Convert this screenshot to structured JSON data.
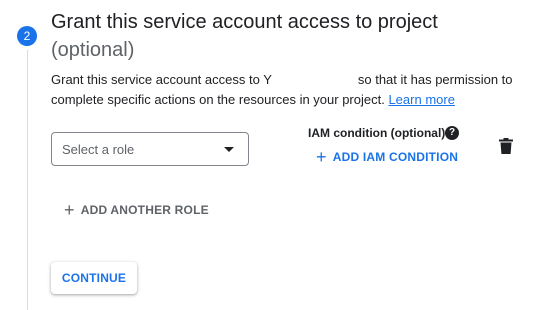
{
  "step": {
    "number": "2",
    "title": "Grant this service account access to project",
    "optional": "(optional)"
  },
  "description": {
    "before": "Grant this service account access to ",
    "hidden_fragment": "Y",
    "after": "so that it has permission to complete specific actions on the resources in your project. ",
    "link": "Learn more"
  },
  "role": {
    "placeholder": "Select a role"
  },
  "iam": {
    "label": "IAM condition (optional)",
    "help_glyph": "?",
    "add_label": "ADD IAM CONDITION"
  },
  "actions": {
    "plus_glyph": "+",
    "add_role_label": "ADD ANOTHER ROLE",
    "continue_label": "CONTINUE"
  },
  "colors": {
    "accent": "#1a73e8",
    "text": "#202124",
    "muted": "#5f6368"
  }
}
